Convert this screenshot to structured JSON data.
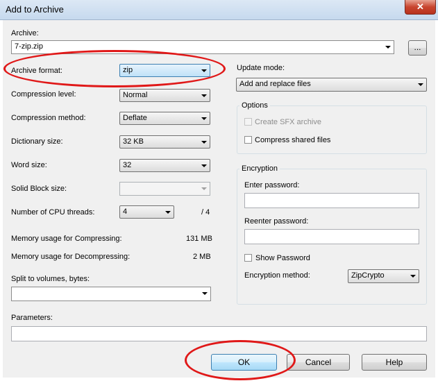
{
  "window": {
    "title": "Add to Archive",
    "close_glyph": "✕"
  },
  "archive": {
    "label": "Archive:",
    "value": "7-zip.zip",
    "browse_label": "..."
  },
  "left": {
    "archive_format": {
      "label": "Archive format:",
      "value": "zip"
    },
    "compression_level": {
      "label": "Compression level:",
      "value": "Normal"
    },
    "compression_method": {
      "label": "Compression method:",
      "value": "Deflate"
    },
    "dictionary_size": {
      "label": "Dictionary size:",
      "value": "32 KB"
    },
    "word_size": {
      "label": "Word size:",
      "value": "32"
    },
    "solid_block": {
      "label": "Solid Block size:",
      "value": ""
    },
    "cpu_threads": {
      "label": "Number of CPU threads:",
      "value": "4",
      "max": "/ 4"
    },
    "mem_compress": {
      "label": "Memory usage for Compressing:",
      "value": "131 MB"
    },
    "mem_decompress": {
      "label": "Memory usage for Decompressing:",
      "value": "2 MB"
    },
    "split": {
      "label": "Split to volumes, bytes:",
      "value": ""
    }
  },
  "right": {
    "update_mode": {
      "label": "Update mode:",
      "value": "Add and replace files"
    },
    "options": {
      "title": "Options",
      "sfx_label": "Create SFX archive",
      "shared_label": "Compress shared files"
    },
    "encryption": {
      "title": "Encryption",
      "enter_label": "Enter password:",
      "reenter_label": "Reenter password:",
      "show_label": "Show Password",
      "method_label": "Encryption method:",
      "method_value": "ZipCrypto"
    }
  },
  "parameters": {
    "label": "Parameters:",
    "value": ""
  },
  "buttons": {
    "ok": "OK",
    "cancel": "Cancel",
    "help": "Help"
  },
  "annotation": {
    "color": "#e01818"
  }
}
